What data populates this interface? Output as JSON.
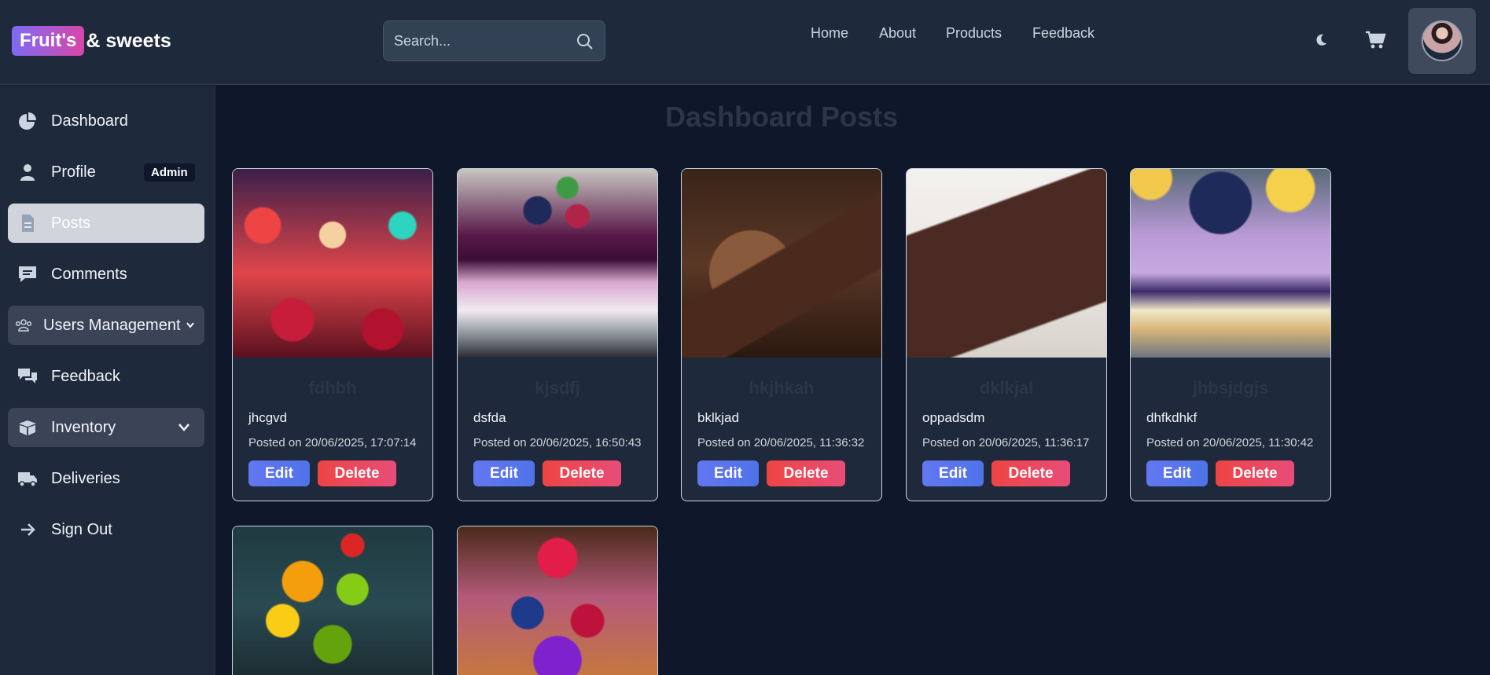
{
  "header": {
    "logo_badge": "Fruit's",
    "logo_rest": "& sweets",
    "search_placeholder": "Search...",
    "nav": [
      "Home",
      "About",
      "Products",
      "Feedback"
    ]
  },
  "sidebar": {
    "items": [
      {
        "label": "Dashboard",
        "icon": "pie-chart-icon"
      },
      {
        "label": "Profile",
        "icon": "user-icon",
        "badge": "Admin"
      },
      {
        "label": "Posts",
        "icon": "document-icon",
        "active": true
      },
      {
        "label": "Comments",
        "icon": "comment-icon"
      },
      {
        "label": "Users Management",
        "icon": "users-icon"
      },
      {
        "label": "Feedback",
        "icon": "chat-icon"
      },
      {
        "label": "Inventory",
        "icon": "box-icon"
      },
      {
        "label": "Deliveries",
        "icon": "truck-icon"
      },
      {
        "label": "Sign Out",
        "icon": "arrow-right-icon"
      }
    ]
  },
  "main": {
    "title": "Dashboard Posts",
    "edit_label": "Edit",
    "delete_label": "Delete",
    "posts": [
      {
        "title": "fdhbh",
        "desc": "jhcgvd",
        "date": "Posted on 20/06/2025, 17:07:14"
      },
      {
        "title": "kjsdfj",
        "desc": "dsfda",
        "date": "Posted on 20/06/2025, 16:50:43"
      },
      {
        "title": "hkjhkah",
        "desc": "bklkjad",
        "date": "Posted on 20/06/2025, 11:36:32"
      },
      {
        "title": "dklkjal",
        "desc": "oppadsdm",
        "date": "Posted on 20/06/2025, 11:36:17"
      },
      {
        "title": "jhbsjdgjs",
        "desc": "dhfkdhkf",
        "date": "Posted on 20/06/2025, 11:30:42"
      }
    ]
  },
  "colors": {
    "accent_start": "#7c6cf5",
    "accent_end": "#d946a8",
    "edit": "#6376f1",
    "delete": "#ef4444"
  }
}
